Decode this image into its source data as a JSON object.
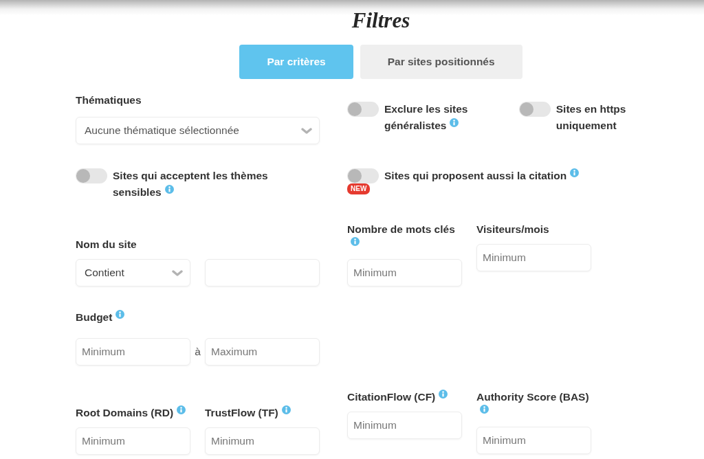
{
  "title": "Filtres",
  "tabs": [
    {
      "label": "Par critères",
      "selected": true
    },
    {
      "label": "Par sites positionnés",
      "selected": false
    }
  ],
  "left_column": [
    {
      "kind": "select",
      "label": "Thématiques",
      "info": false,
      "value": "Aucune thématique sélectionnée"
    },
    {
      "kind": "toggle",
      "label": "Sites qui acceptent les thèmes sensibles",
      "info": true,
      "on": false
    },
    {
      "kind": "text_filter",
      "label": "Nom du site",
      "info": false,
      "operator": "Contient"
    },
    {
      "kind": "range",
      "label": "Budget",
      "info": true,
      "min_placeholder": "Minimum",
      "separator": "à",
      "max_placeholder": "Maximum"
    },
    {
      "kind": "field_pair",
      "fields": [
        {
          "label": "Root Domains (RD)",
          "info": true,
          "placeholder": "Minimum"
        },
        {
          "label": "TrustFlow (TF)",
          "info": true,
          "placeholder": "Minimum"
        }
      ]
    }
  ],
  "right_column": [
    {
      "kind": "toggle_pair",
      "toggles": [
        {
          "label": "Exclure les sites généralistes",
          "info": true,
          "on": false
        },
        {
          "label": "Sites en https uniquement",
          "info": false,
          "on": false
        }
      ]
    },
    {
      "kind": "toggle",
      "label": "Sites qui proposent aussi la citation",
      "info": true,
      "on": false,
      "badge": "NEW"
    },
    {
      "kind": "field_pair",
      "fields": [
        {
          "label": "Nombre de mots clés",
          "info": true,
          "placeholder": "Minimum"
        },
        {
          "label": "Visiteurs/mois",
          "info": false,
          "placeholder": "Minimum"
        }
      ]
    },
    {
      "kind": "field_pair",
      "fields": [
        {
          "label": "CitationFlow (CF)",
          "info": true,
          "placeholder": "Minimum"
        },
        {
          "label": "Authority Score (BAS)",
          "info": true,
          "placeholder": "Minimum"
        }
      ]
    }
  ]
}
